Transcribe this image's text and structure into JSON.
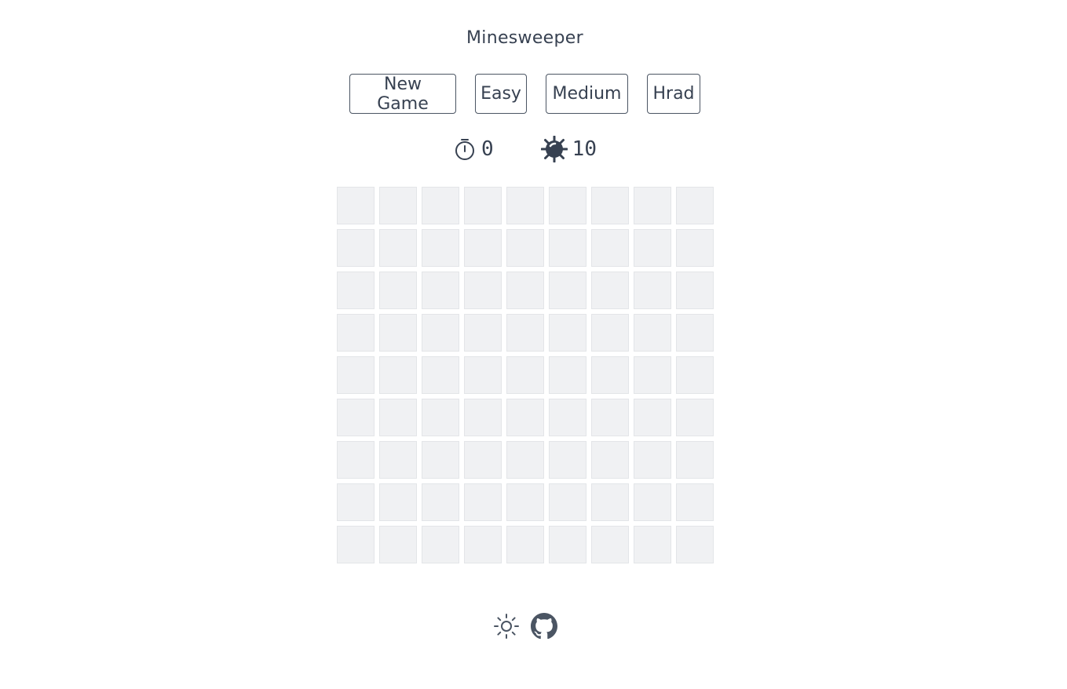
{
  "header": {
    "title": "Minesweeper"
  },
  "controls": {
    "new_game_label": "New Game",
    "easy_label": "Easy",
    "medium_label": "Medium",
    "hard_label": "Hrad"
  },
  "stats": {
    "timer_icon": "timer-icon",
    "timer_value": "0",
    "mines_icon": "mine-icon",
    "mines_value": "10"
  },
  "board": {
    "rows": 9,
    "cols": 9,
    "state": "all-covered"
  },
  "footer": {
    "theme_icon": "sun-icon",
    "github_icon": "github-icon"
  },
  "colors": {
    "text": "#374151",
    "cell_bg": "#f0f1f3",
    "cell_border": "#e3e5e8"
  }
}
